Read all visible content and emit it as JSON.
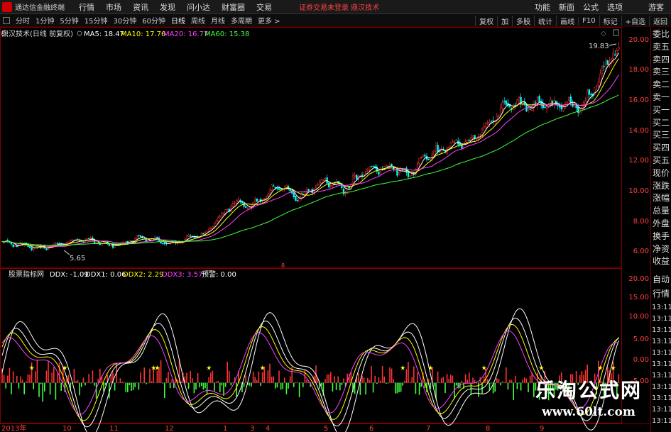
{
  "window": {
    "app_title": "通达信金融终端",
    "menu": [
      "行情",
      "市场",
      "资讯",
      "发现",
      "问小达",
      "财富圈",
      "交易"
    ],
    "notice": "证券交易未登录   鼎汉技术",
    "right_menu": [
      "功能",
      "新面",
      "公式",
      "选项"
    ],
    "login": "游客"
  },
  "periods": {
    "items": [
      "分时",
      "1分钟",
      "5分钟",
      "15分钟",
      "30分钟",
      "60分钟",
      "日线",
      "周线",
      "月线",
      "多周期",
      "更多 >"
    ],
    "active": "日线",
    "right_items": [
      "复权",
      "加",
      "多股",
      "统计",
      "画线",
      "F10",
      "标记",
      "+自选",
      "返回"
    ]
  },
  "main_legend": {
    "title": "鼎汉技术(日线 前复权)",
    "items": [
      {
        "text": "MA5: 18.47",
        "color": "#ffffff"
      },
      {
        "text": "MA10: 17.76",
        "color": "#ffff00"
      },
      {
        "text": "MA20: 16.77",
        "color": "#ff40ff"
      },
      {
        "text": "MA60: 15.38",
        "color": "#40ff40"
      }
    ]
  },
  "sub_legend": {
    "title": "股票指标网",
    "items": [
      {
        "text": "DDX: -1.09",
        "color": "#ffffff"
      },
      {
        "text": "DDX1: 0.06",
        "color": "#ffffff"
      },
      {
        "text": "DDX2: 2.29",
        "color": "#ffff00"
      },
      {
        "text": "DDX3: 3.57",
        "color": "#ff40ff"
      },
      {
        "text": "预警: 0.00",
        "color": "#ffffff"
      }
    ]
  },
  "price_axis": [
    "20.00",
    "18.00",
    "16.00",
    "14.00",
    "12.00",
    "10.00",
    "8.00",
    "6.00"
  ],
  "sub_axis": [
    "20.00",
    "15.00",
    "10.00",
    "5.00",
    "0.00",
    "-5.00"
  ],
  "annotations": {
    "low": "5.65",
    "high": "19.83",
    "marker": "8"
  },
  "date_axis": [
    "2013年",
    "10",
    "11",
    "12",
    "1",
    "3",
    "4",
    "5",
    "6",
    "7",
    "8",
    "9"
  ],
  "side_quote": [
    "委比",
    "卖五",
    "卖四",
    "卖三",
    "卖二",
    "卖一",
    "买一",
    "买二",
    "买三",
    "买四",
    "买五",
    "现价",
    "涨跌",
    "涨幅",
    "总量",
    "外盘",
    "换手",
    "净资",
    "收益"
  ],
  "side_sub": [
    "自动",
    "行情"
  ],
  "side_times": [
    "13:11",
    "13:11",
    "13:11",
    "13:11",
    "13:11",
    "13:11",
    "13:11",
    "13:11",
    "13:11",
    "13:11",
    "13:11"
  ],
  "watermark": {
    "line1": "乐淘公式网",
    "line2": "www.60lt.com"
  },
  "colors": {
    "up": "#ff3333",
    "down": "#00ffff",
    "ma5": "#ffffff",
    "ma10": "#ffff00",
    "ma20": "#ff40ff",
    "ma60": "#40ff40",
    "axis": "#800000"
  },
  "chart_data": {
    "type": "candlestick",
    "price_ylim": [
      5.0,
      20.8
    ],
    "price_key_points": [
      [
        0,
        6.6
      ],
      [
        20,
        6.2
      ],
      [
        35,
        6.6
      ],
      [
        45,
        6.8
      ],
      [
        60,
        6.3
      ],
      [
        75,
        6.9
      ],
      [
        92,
        6.5
      ],
      [
        110,
        7.2
      ],
      [
        125,
        9.4
      ],
      [
        135,
        9.0
      ],
      [
        150,
        10.6
      ],
      [
        160,
        9.6
      ],
      [
        175,
        11.0
      ],
      [
        185,
        10.2
      ],
      [
        195,
        11.4
      ],
      [
        210,
        11.9
      ],
      [
        220,
        11.2
      ],
      [
        230,
        12.6
      ],
      [
        245,
        13.4
      ],
      [
        255,
        13.7
      ],
      [
        265,
        15.1
      ],
      [
        275,
        16.2
      ],
      [
        285,
        16.1
      ],
      [
        300,
        16.1
      ],
      [
        315,
        16.0
      ],
      [
        330,
        19.6
      ]
    ],
    "sub_ylim": [
      -7.5,
      21.5
    ]
  }
}
